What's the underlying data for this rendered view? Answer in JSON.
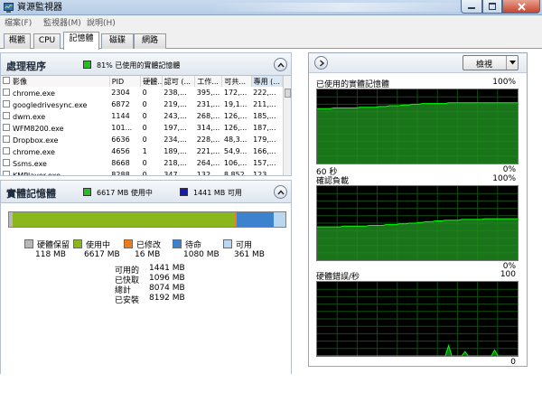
{
  "window": {
    "title": "資源監視器",
    "blurred_title_text": ""
  },
  "menus": [
    "檔案(F)",
    "監視器(M)",
    "說明(H)"
  ],
  "tabs": [
    {
      "label": "概觀"
    },
    {
      "label": "CPU"
    },
    {
      "label": "記憶體"
    },
    {
      "label": "磁碟"
    },
    {
      "label": "網路"
    }
  ],
  "active_tab": 2,
  "processes": {
    "title": "處理程序",
    "status_text": "81% 已使用的實體記憶體",
    "status_color": "#22c022",
    "columns": [
      "影像",
      "PID",
      "硬體...",
      "認可 (...",
      "工作...",
      "可共...",
      "專用 (..."
    ],
    "rows": [
      [
        "chrome.exe",
        "2304",
        "0",
        "238,...",
        "395,...",
        "172,...",
        "222,..."
      ],
      [
        "googledrivesync.exe",
        "6872",
        "0",
        "219,...",
        "231,...",
        "19,1...",
        "211,..."
      ],
      [
        "dwm.exe",
        "1144",
        "0",
        "243,...",
        "268,...",
        "126,...",
        "185,..."
      ],
      [
        "WFM8200.exe",
        "101...",
        "0",
        "197,...",
        "314,...",
        "126,...",
        "187,..."
      ],
      [
        "Dropbox.exe",
        "6636",
        "0",
        "234,...",
        "228,...",
        "48,3...",
        "179,..."
      ],
      [
        "chrome.exe",
        "4656",
        "1",
        "189,...",
        "221,...",
        "54,9...",
        "166,..."
      ],
      [
        "Ssms.exe",
        "8668",
        "0",
        "218,...",
        "264,...",
        "106,...",
        "157,..."
      ],
      [
        "KMPlayer.exe",
        "8288",
        "0",
        "347,...",
        "132,...",
        "8,852",
        "123,..."
      ]
    ]
  },
  "physical_memory": {
    "title": "實體記憶體",
    "in_use_text": "6617 MB 使用中",
    "in_use_color": "#22c022",
    "available_text": "1441 MB 可用",
    "available_color": "#1a1aa8",
    "bar_segments": [
      {
        "name": "hardware_reserved",
        "mb": 118,
        "color": "#b8b8b8"
      },
      {
        "name": "in_use",
        "mb": 6617,
        "color": "#8ab81c"
      },
      {
        "name": "modified",
        "mb": 16,
        "color": "#f07c18"
      },
      {
        "name": "standby",
        "mb": 1080,
        "color": "#3d82cf"
      },
      {
        "name": "free",
        "mb": 361,
        "color": "#b9d6f3"
      }
    ],
    "legend": [
      {
        "label": "硬體保留",
        "value": "118 MB",
        "color": "#b8b8b8"
      },
      {
        "label": "使用中",
        "value": "6617 MB",
        "color": "#8ab81c"
      },
      {
        "label": "已修改",
        "value": "16 MB",
        "color": "#f07c18"
      },
      {
        "label": "待命",
        "value": "1080 MB",
        "color": "#3d82cf"
      },
      {
        "label": "可用",
        "value": "361 MB",
        "color": "#b9d6f3"
      }
    ],
    "stats": [
      {
        "label": "可用的",
        "value": "1441 MB"
      },
      {
        "label": "已快取",
        "value": "1096 MB"
      },
      {
        "label": "總計",
        "value": "8074 MB"
      },
      {
        "label": "已安裝",
        "value": "8192 MB"
      }
    ]
  },
  "right_panel": {
    "view_button": "檢視",
    "expand_icon": "chevron-right-icon",
    "dropdown_icon": "triangle-down-icon"
  },
  "charts": [
    {
      "title": "已使用的實體記憶體",
      "top_label": "100%",
      "bottom_left": "60 秒",
      "bottom_right": "0%",
      "fill": "#1e8a1e",
      "line": "#00ff00",
      "values": [
        74,
        74,
        74,
        74,
        74,
        75,
        75,
        75,
        75,
        75,
        75,
        75,
        75,
        76,
        76,
        76,
        76,
        76,
        76,
        77,
        77,
        77,
        78,
        78,
        78,
        78,
        79,
        79,
        79,
        80,
        80,
        80,
        81,
        81,
        81,
        81,
        81,
        81,
        81,
        81,
        82,
        82,
        82,
        82,
        82,
        82,
        82,
        82,
        82,
        82,
        82,
        82,
        82,
        82,
        82,
        82,
        82,
        82,
        82,
        82,
        82,
        82
      ]
    },
    {
      "title": "確認負載",
      "top_label": "100%",
      "bottom_left": "",
      "bottom_right": "0%",
      "fill": "#1e8a1e",
      "line": "#00ff00",
      "values": [
        45,
        45,
        45,
        45,
        45,
        45,
        45,
        45,
        46,
        46,
        46,
        46,
        46,
        46,
        46,
        46,
        47,
        47,
        47,
        47,
        47,
        48,
        48,
        48,
        48,
        49,
        49,
        49,
        50,
        50,
        50,
        51,
        51,
        52,
        52,
        52,
        53,
        53,
        53,
        54,
        54,
        54,
        54,
        54,
        55,
        55,
        55,
        55,
        55,
        55,
        55,
        56,
        56,
        56,
        56,
        56,
        56,
        56,
        56,
        56,
        56,
        56
      ]
    },
    {
      "title": "硬體錯誤/秒",
      "top_label": "100",
      "bottom_left": "",
      "bottom_right": "0",
      "fill": "#1e8a1e",
      "line": "#00ff00",
      "values": [
        0,
        0,
        0,
        0,
        0,
        0,
        0,
        0,
        0,
        0,
        0,
        0,
        0,
        0,
        0,
        0,
        0,
        0,
        0,
        0,
        0,
        0,
        0,
        0,
        0,
        0,
        0,
        0,
        0,
        0,
        0,
        0,
        0,
        0,
        0,
        0,
        0,
        0,
        0,
        0,
        14,
        0,
        0,
        0,
        0,
        6,
        0,
        0,
        0,
        0,
        0,
        0,
        0,
        0,
        8,
        0,
        0,
        0,
        0,
        0,
        0,
        0
      ]
    }
  ]
}
